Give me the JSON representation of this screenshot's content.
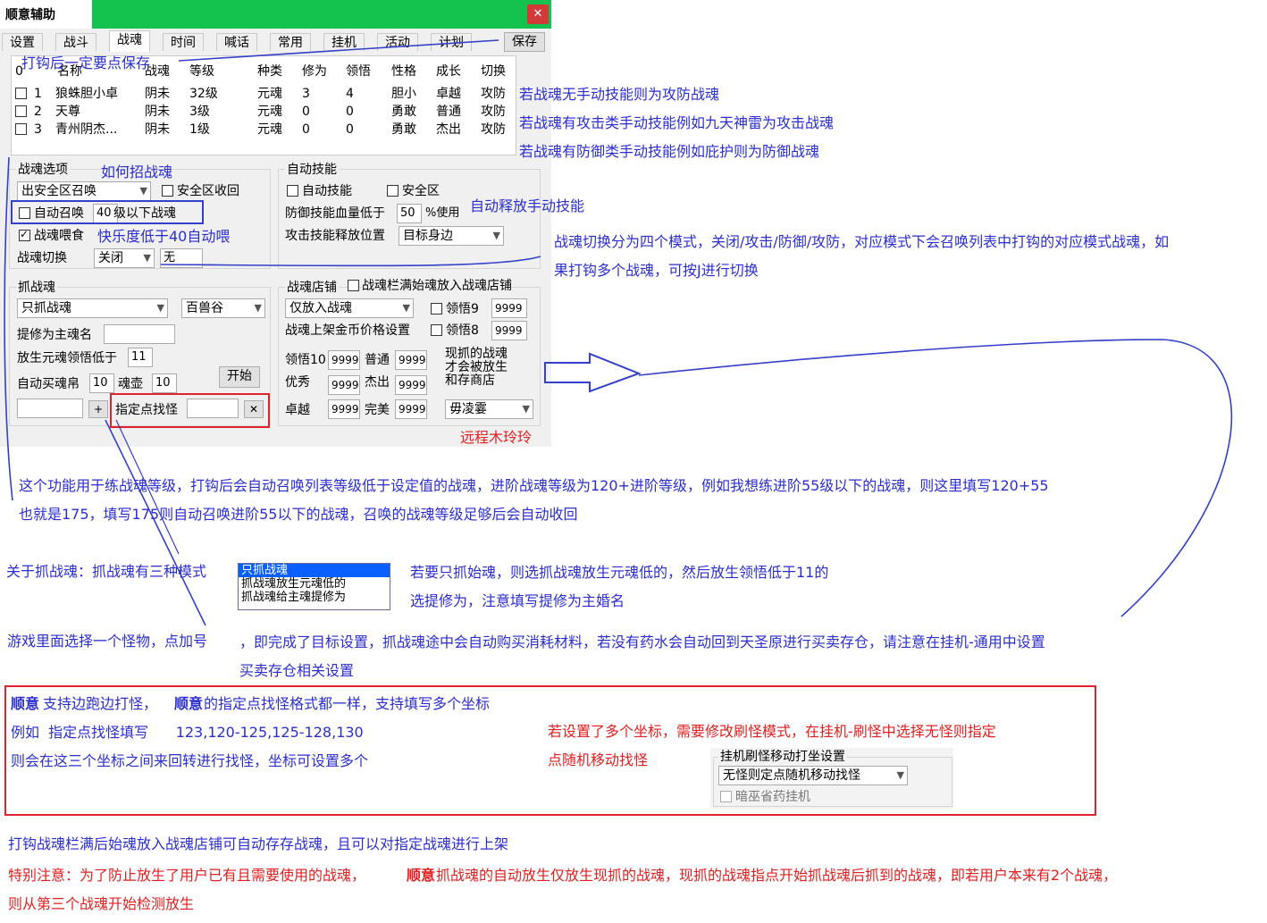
{
  "window": {
    "title": "顺意辅助",
    "close": "✕",
    "tabs": [
      "设置",
      "战斗",
      "战魂",
      "时间",
      "喊话",
      "常用",
      "挂机",
      "活动",
      "计划"
    ],
    "save_button": "保存"
  },
  "list": {
    "headers": [
      "0",
      "名称",
      "战魂",
      "等级",
      "种类",
      "修为",
      "领悟",
      "性格",
      "成长",
      "切换"
    ],
    "rows": [
      {
        "idx": "1",
        "name": "狼蛛胆小卓",
        "soul": "阴未",
        "level": "32级",
        "kind": "元魂",
        "xiuwei": "3",
        "lingwu": "4",
        "xingge": "胆小",
        "chengzhang": "卓越",
        "qiehuan": "攻防"
      },
      {
        "idx": "2",
        "name": "天尊",
        "soul": "阴未",
        "level": "3级",
        "kind": "元魂",
        "xiuwei": "0",
        "lingwu": "0",
        "xingge": "勇敢",
        "chengzhang": "普通",
        "qiehuan": "攻防"
      },
      {
        "idx": "3",
        "name": "青州阴杰...",
        "soul": "阴未",
        "level": "1级",
        "kind": "元魂",
        "xiuwei": "0",
        "lingwu": "0",
        "xingge": "勇敢",
        "chengzhang": "杰出",
        "qiehuan": "攻防"
      }
    ]
  },
  "soul_options": {
    "group": "战魂选项",
    "summon_combo": "出安全区召唤",
    "safe_recall": "安全区收回",
    "auto_summon": "自动召唤",
    "auto_summon_level": "40",
    "auto_summon_suffix": "级以下战魂",
    "feed": "战魂喂食",
    "switch_label": "战魂切换",
    "switch_combo": "关闭",
    "switch_value": "无"
  },
  "auto_skill": {
    "group": "自动技能",
    "auto_skill": "自动技能",
    "safe_zone": "安全区",
    "defense_label": "防御技能血量低于",
    "defense_value": "50",
    "defense_suffix": "%使用",
    "attack_label": "攻击技能释放位置",
    "attack_combo": "目标身边"
  },
  "catch": {
    "group": "抓战魂",
    "mode_combo": "只抓战魂",
    "map_combo": "百兽谷",
    "name_label": "提修为主魂名",
    "release_label": "放生元魂领悟低于",
    "release_value": "11",
    "buy_label": "自动买魂帛",
    "buy_value": "10",
    "pot_label": "魂壶",
    "pot_value": "10",
    "start_button": "开始",
    "plus_button": "+",
    "point_label": "指定点找怪",
    "clear_button": "✕"
  },
  "shop": {
    "group": "战魂店铺",
    "full_put": "战魂栏满始魂放入战魂店铺",
    "put_combo": "仅放入战魂",
    "lingwu9": "领悟9",
    "lingwu9_value": "9999",
    "price_label": "战魂上架金币价格设置",
    "lingwu8": "领悟8",
    "lingwu8_value": "9999",
    "lingwu10": "领悟10",
    "lingwu10_value": "9999",
    "putong": "普通",
    "putong_value": "9999",
    "youxiu": "优秀",
    "youxiu_value": "9999",
    "jiechu": "杰出",
    "jiechu_value": "9999",
    "zhuoyue": "卓越",
    "zhuoyue_value": "9999",
    "wanmei": "完美",
    "wanmei_value": "9999",
    "note_lines": [
      "现抓的战魂",
      "才会被放生",
      "和存商店"
    ],
    "npc_combo": "毋凌霎"
  },
  "annotations": {
    "save_hint": "打钩后一定要点保存",
    "attack_def": "若战魂无手动技能则为攻防战魂",
    "attack": "若战魂有攻击类手动技能例如九天神雷为攻击战魂",
    "defense": "若战魂有防御类手动技能例如庇护则为防御战魂",
    "how_summon": "如何招战魂",
    "auto_release": "自动释放手动技能",
    "feed_hint": "快乐度低于40自动喂",
    "switch_line1": "战魂切换分为四个模式，关闭/攻击/防御/攻防，对应模式下会召唤列表中打钩的对应模式战魂，如",
    "switch_line2": "果打钩多个战魂，可按J进行切换",
    "remote_npc": "远程木玲玲",
    "level_line1": "这个功能用于练战魂等级，打钩后会自动召唤列表等级低于设定值的战魂，进阶战魂等级为120+进阶等级，例如我想练进阶55级以下的战魂，则这里填写120+55",
    "level_line2": "也就是175，填写175则自动召唤进阶55以下的战魂，召唤的战魂等级足够后会自动收回",
    "catch_modes": "关于抓战魂：抓战魂有三种模式",
    "mode_options": [
      "只抓战魂",
      "抓战魂放生元魂低的",
      "抓战魂给主魂提修为"
    ],
    "catch_hint1": "若要只抓始魂，则选抓战魂放生元魂低的，然后放生领悟低于11的",
    "catch_hint2": "选提修为，注意填写提修为主婚名",
    "select_monster": "游戏里面选择一个怪物，点加号",
    "target_set_1": "，即完成了目标设置，抓战魂途中会自动购买消耗材料，若没有药水会自动回到天圣原进行买卖存仓，请注意在挂机-通用中设置",
    "target_set_2": "买卖存仓相关设置",
    "box_brand": "顺意",
    "box_line1_a": "支持边跑边打怪，",
    "box_line1_b": "的指定点找怪格式都一样，支持填写多个坐标",
    "box_line2": "例如  指定点找怪填写      123,120-125,125-128,130",
    "box_line3": "则会在这三个坐标之间来回转进行找怪，坐标可设置多个",
    "box_red1": "若设置了多个坐标，需要修改刷怪模式，在挂机-刷怪中选择无怪则指定",
    "box_red2": "点随机移动找怪",
    "shot_title": "挂机刷怪移动打坐设置",
    "shot_combo": "无怪则定点随机移动找怪",
    "shot_check": "暗巫省药挂机",
    "bottom1": "打钩战魂栏满后始魂放入战魂店铺可自动存存战魂，且可以对指定战魂进行上架",
    "bottom2_a": "特别注意：为了防止放生了用户已有且需要使用的战魂，",
    "bottom2_brand": "顺意",
    "bottom2_b": " 抓战魂的自动放生仅放生现抓的战魂，现抓的战魂指点开始抓战魂后抓到的战魂，即若用户本来有2个战魂，",
    "bottom3": "则从第三个战魂开始检测放生"
  },
  "colors": {
    "titlebar": "#14c34d",
    "annotation_blue": "#2b2ecf",
    "annotation_red": "#e02020",
    "box_red": "#e0212e"
  }
}
